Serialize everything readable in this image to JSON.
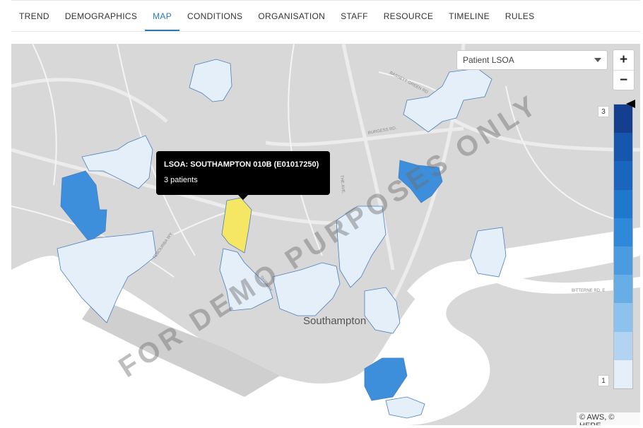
{
  "tabs": [
    {
      "label": "TREND"
    },
    {
      "label": "DEMOGRAPHICS"
    },
    {
      "label": "MAP",
      "active": true
    },
    {
      "label": "CONDITIONS"
    },
    {
      "label": "ORGANISATION"
    },
    {
      "label": "STAFF"
    },
    {
      "label": "RESOURCE"
    },
    {
      "label": "TIMELINE"
    },
    {
      "label": "RULES"
    }
  ],
  "map": {
    "layer_select": {
      "value": "Patient LSOA"
    },
    "zoom": {
      "in_label": "+",
      "out_label": "−"
    },
    "legend": {
      "max_label": "3",
      "min_label": "1",
      "colors": [
        "#143f8f",
        "#1657ad",
        "#1a66bf",
        "#1f78cc",
        "#2f88d8",
        "#4a9be0",
        "#68aee6",
        "#8cc2ee",
        "#b3d3f3",
        "#e5eff9"
      ]
    },
    "tooltip": {
      "title": "LSOA: SOUTHAMPTON 010B (E01017250)",
      "value": "3 patients"
    },
    "watermark": "FOR DEMO PURPOSES ONLY",
    "city_label": "Southampton",
    "road_labels": {
      "bassett": "BASSETT GREEN RD",
      "burgess": "BURGESS RD.",
      "ave": "THE AVE.",
      "bitterne": "BITTERNE RD. E",
      "tebourba": "TEBOURBA WY",
      "shirley": "SHIRLEY"
    },
    "attribution": "© AWS, © HERE",
    "highlight_color": "#f5e664"
  }
}
